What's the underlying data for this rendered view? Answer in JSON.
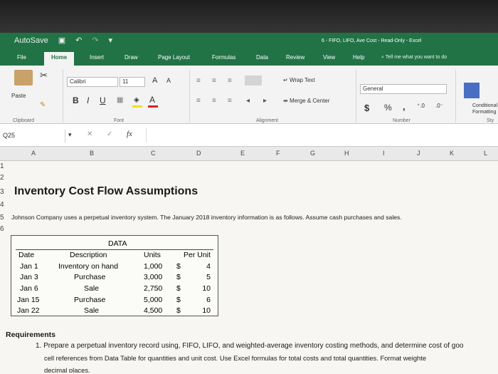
{
  "titlebar": {
    "autosave": "AutoSave",
    "title": "6 - FIFO, LIFO, Ave Cost  -  Read-Only  -  Excel"
  },
  "tabs": [
    "File",
    "Home",
    "Insert",
    "Draw",
    "Page Layout",
    "Formulas",
    "Data",
    "Review",
    "View",
    "Help"
  ],
  "tell_me": "Tell me what you want to do",
  "ribbon": {
    "paste": "Paste",
    "clipboard": "Clipboard",
    "font_name": "Calibri",
    "font_size": "11",
    "bold": "B",
    "italic": "I",
    "underline": "U",
    "grow_font": "A",
    "shrink_font": "A",
    "font_color_label": "A",
    "font_group": "Font",
    "wrap_text": "Wrap Text",
    "merge_center": "Merge & Center",
    "alignment_group": "Alignment",
    "number_format": "General",
    "currency": "$",
    "percent": "%",
    "comma": ",",
    "number_group": "Number",
    "conditional_formatting": "Conditional Formatting",
    "styles_partial": "Sty"
  },
  "formula_bar": {
    "name_box": "Q25",
    "fx": "fx",
    "value": ""
  },
  "columns": [
    "A",
    "B",
    "C",
    "D",
    "E",
    "F",
    "G",
    "H",
    "I",
    "J",
    "K",
    "L"
  ],
  "rows": [
    "1",
    "2",
    "3",
    "4",
    "5",
    "6"
  ],
  "sheet": {
    "heading": "Inventory Cost Flow Assumptions",
    "intro": "Johnson Company uses a perpetual inventory system.  The January 2018 inventory information is as follows.  Assume cash purchases and sales.",
    "table": {
      "title": "DATA",
      "headers": {
        "date": "Date",
        "description": "Description",
        "units": "Units",
        "per_unit": "Per Unit"
      },
      "rows": [
        {
          "date": "Jan 1",
          "description": "Inventory on hand",
          "units": "1,000",
          "cur": "$",
          "per_unit": "4"
        },
        {
          "date": "Jan 3",
          "description": "Purchase",
          "units": "3,000",
          "cur": "$",
          "per_unit": "5"
        },
        {
          "date": "Jan 6",
          "description": "Sale",
          "units": "2,750",
          "cur": "$",
          "per_unit": "10"
        },
        {
          "date": "Jan 15",
          "description": "Purchase",
          "units": "5,000",
          "cur": "$",
          "per_unit": "6"
        },
        {
          "date": "Jan 22",
          "description": "Sale",
          "units": "4,500",
          "cur": "$",
          "per_unit": "10"
        }
      ]
    },
    "requirements_title": "Requirements",
    "requirement_1_line1": "1. Prepare a perpetual inventory record using, FIFO, LIFO, and weighted-average inventory costing methods, and determine cost of goo",
    "requirement_1_line2": "cell references from Data Table for quantities and unit cost.  Use Excel formulas for total costs and total quantities.  Format weighte",
    "requirement_1_line3": "decimal places."
  },
  "colors": {
    "excel_green": "#217346",
    "ribbon_bg": "#f3f3f3",
    "font_red": "#e02020",
    "fill_yellow": "#f2e100"
  }
}
